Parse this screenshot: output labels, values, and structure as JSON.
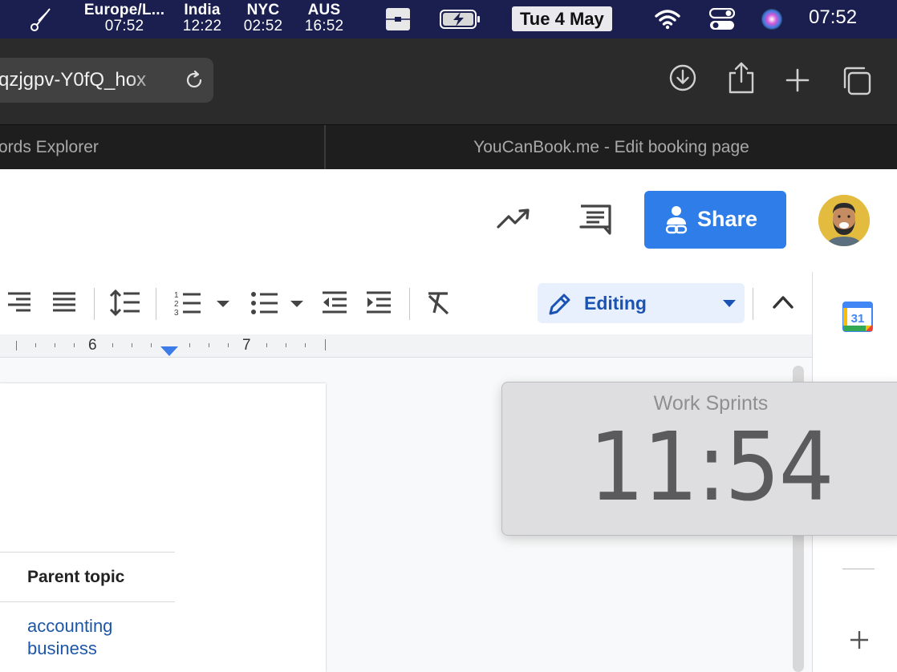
{
  "menubar": {
    "clocks": [
      {
        "city": "Europe/L...",
        "time": "07:52"
      },
      {
        "city": "India",
        "time": "12:22"
      },
      {
        "city": "NYC",
        "time": "02:52"
      },
      {
        "city": "AUS",
        "time": "16:52"
      }
    ],
    "date": "Tue 4 May",
    "time": "07:52"
  },
  "browser": {
    "url": "qzjgpv-Y0fQ_hox",
    "tabs": [
      {
        "title": "ords Explorer"
      },
      {
        "title": "YouCanBook.me - Edit booking page"
      }
    ]
  },
  "docs": {
    "share_label": "Share",
    "editing_label": "Editing",
    "ruler_numbers": [
      "6",
      "7"
    ]
  },
  "document": {
    "column_header": "Parent topic",
    "topics": [
      "accounting",
      "business"
    ]
  },
  "widget": {
    "title": "Work Sprints",
    "time": "11:54"
  },
  "side_panel": {
    "calendar_day": "31"
  },
  "colors": {
    "menubar": "#1b1f4f",
    "share_button": "#2f7de9",
    "editing_bg": "#e8f0fe",
    "link": "#1d56a8"
  }
}
